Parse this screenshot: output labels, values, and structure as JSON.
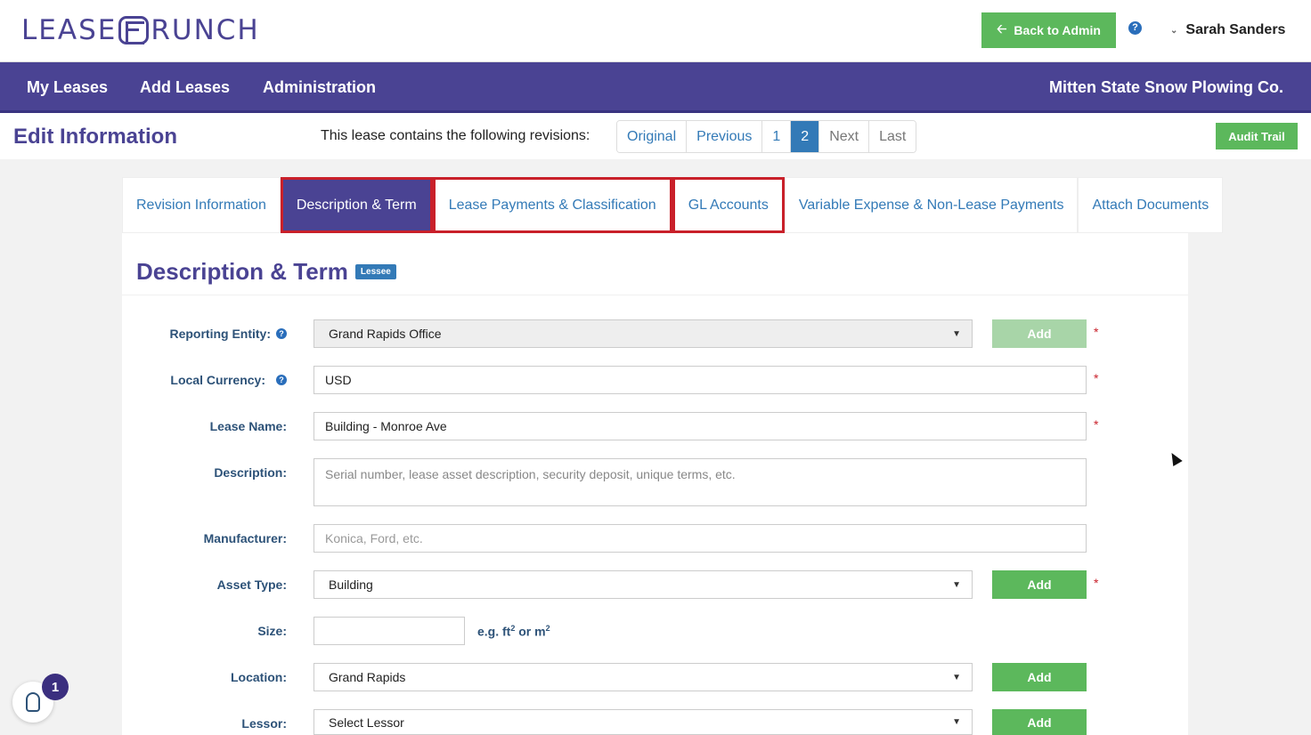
{
  "header": {
    "logo_text": "LEASECRUNCH",
    "back_to_admin": "Back to Admin",
    "user_name": "Sarah Sanders"
  },
  "nav": {
    "items": [
      "My Leases",
      "Add Leases",
      "Administration"
    ],
    "company": "Mitten State Snow Plowing Co."
  },
  "subheader": {
    "title": "Edit Information",
    "revisions_text": "This lease contains the following revisions:",
    "pager": [
      "Original",
      "Previous",
      "1",
      "2",
      "Next",
      "Last"
    ],
    "pager_active": "2",
    "audit_trail": "Audit Trail"
  },
  "tabs": [
    "Revision Information",
    "Description & Term",
    "Lease Payments & Classification",
    "GL Accounts",
    "Variable Expense & Non-Lease Payments",
    "Attach Documents"
  ],
  "active_tab": "Description & Term",
  "section": {
    "title": "Description & Term",
    "badge": "Lessee"
  },
  "form": {
    "reporting_entity": {
      "label": "Reporting Entity:",
      "value": "Grand Rapids Office",
      "add": "Add"
    },
    "local_currency": {
      "label": "Local Currency:",
      "value": "USD"
    },
    "lease_name": {
      "label": "Lease Name:",
      "value": "Building - Monroe Ave"
    },
    "description": {
      "label": "Description:",
      "placeholder": "Serial number, lease asset description, security deposit, unique terms, etc."
    },
    "manufacturer": {
      "label": "Manufacturer:",
      "placeholder": "Konica, Ford, etc."
    },
    "asset_type": {
      "label": "Asset Type:",
      "value": "Building",
      "add": "Add"
    },
    "size": {
      "label": "Size:",
      "hint_prefix": "e.g. ft",
      "hint_mid": " or m",
      "sup": "2"
    },
    "location": {
      "label": "Location:",
      "value": "Grand Rapids",
      "add": "Add"
    },
    "lessor": {
      "label": "Lessor:",
      "value": "Select Lessor",
      "add": "Add"
    },
    "required_mark": "*"
  },
  "help_widget": {
    "count": "1"
  },
  "colors": {
    "brand_purple": "#4a4393",
    "green": "#5cb85c",
    "link_blue": "#337ab7",
    "highlight_red": "#c9202a"
  }
}
